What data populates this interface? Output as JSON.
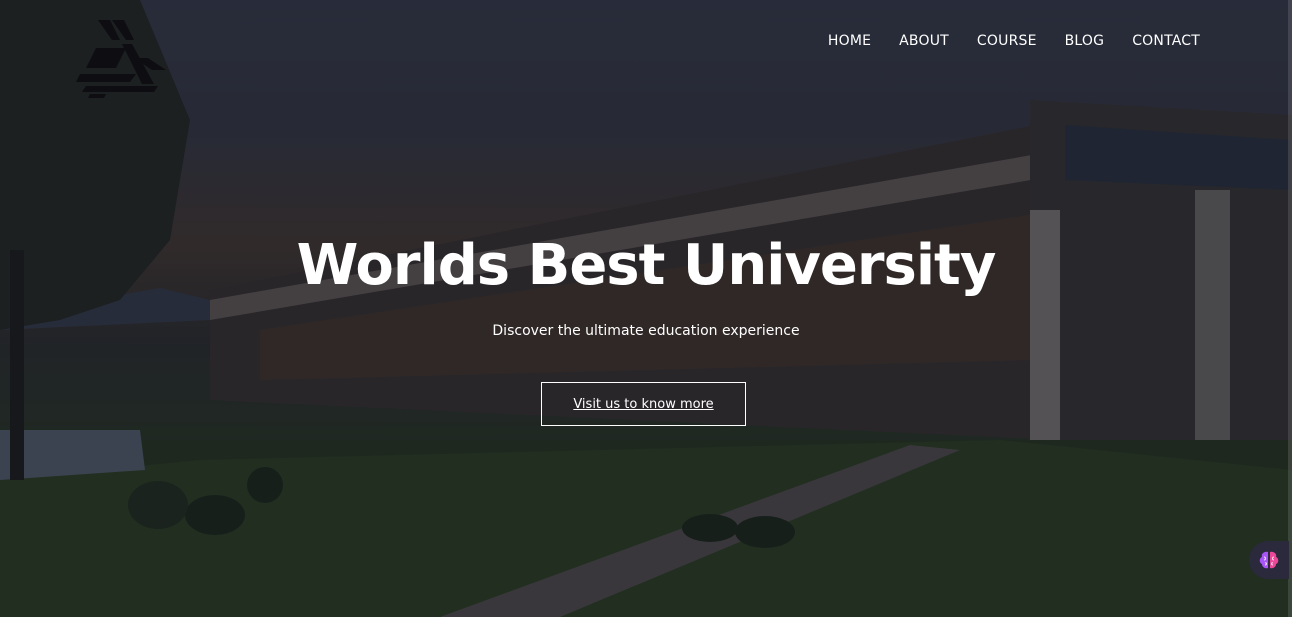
{
  "nav": {
    "items": [
      {
        "label": "HOME"
      },
      {
        "label": "ABOUT"
      },
      {
        "label": "COURSE"
      },
      {
        "label": "BLOG"
      },
      {
        "label": "CONTACT"
      }
    ]
  },
  "hero": {
    "title": "Worlds Best University",
    "subtitle": "Discover the ultimate education experience",
    "cta_label": "Visit us to know more"
  },
  "icons": {
    "logo": "university-logo-icon",
    "assistant": "brain-icon"
  },
  "colors": {
    "text": "#ffffff",
    "overlay": "#12141e",
    "fab_background": "#2b2a3d"
  }
}
